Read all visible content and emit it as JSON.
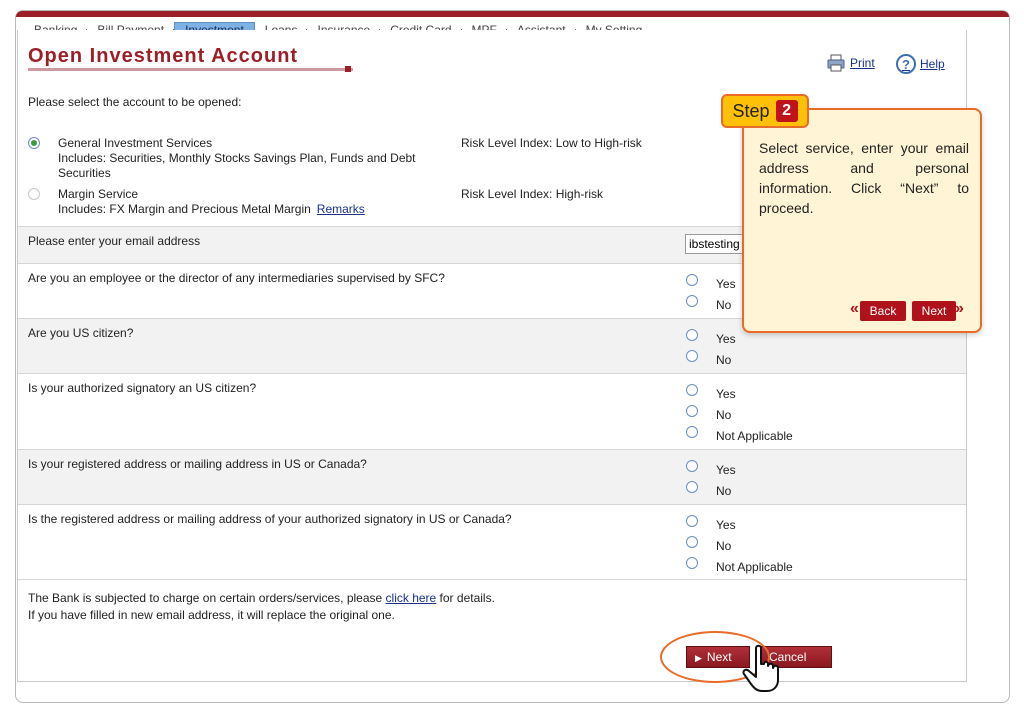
{
  "nav": {
    "tabs": [
      {
        "label": "Banking"
      },
      {
        "label": "Bill Payment"
      },
      {
        "label": "Investment",
        "active": true
      },
      {
        "label": "Loans"
      },
      {
        "label": "Insurance"
      },
      {
        "label": "Credit Card"
      },
      {
        "label": "MPF"
      },
      {
        "label": "Assistant"
      },
      {
        "label": "My Setting"
      }
    ]
  },
  "page": {
    "title": "Open Investment Account",
    "print_label": "Print",
    "help_label": "Help",
    "prompt": "Please select the account to be opened:"
  },
  "accounts": [
    {
      "name": "General Investment Services",
      "includes": "Includes: Securities, Monthly Stocks Savings Plan, Funds and Debt Securities",
      "risk": "Risk Level Index: Low to High-risk",
      "selected": true
    },
    {
      "name": "Margin Service",
      "includes": "Includes: FX Margin and Precious Metal Margin",
      "remarks": "Remarks",
      "risk": "Risk Level Index: High-risk",
      "selected": false
    }
  ],
  "email": {
    "question": "Please enter your email address",
    "value": "ibstesting"
  },
  "questions": [
    {
      "text": "Are you an employee or the director of any intermediaries supervised by SFC?",
      "options": [
        "Yes",
        "No"
      ]
    },
    {
      "text": "Are you US citizen?",
      "options": [
        "Yes",
        "No"
      ]
    },
    {
      "text": "Is your authorized signatory an US citizen?",
      "options": [
        "Yes",
        "No",
        "Not Applicable"
      ]
    },
    {
      "text": "Is your registered address or mailing address in US or Canada?",
      "options": [
        "Yes",
        "No"
      ]
    },
    {
      "text": "Is the registered address or mailing address of your authorized signatory in US or Canada?",
      "options": [
        "Yes",
        "No",
        "Not Applicable"
      ]
    }
  ],
  "footer": {
    "line1_a": "The Bank is subjected to charge on certain orders/services, please ",
    "line1_link": "click here",
    "line1_b": " for details.",
    "line2": "If you have filled in new email address, it will replace the original one."
  },
  "buttons": {
    "next": "Next",
    "cancel": "Cancel"
  },
  "tutorial": {
    "step_label": "Step",
    "step_number": "2",
    "text": "Select service, enter your email address and personal information. Click “Next” to proceed.",
    "back_label": "Back",
    "next_label": "Next"
  },
  "colors": {
    "brand": "#9c1f27",
    "highlight": "#e86b2a",
    "step_bg": "#fff5d6",
    "active_tab": "#7fb2e4"
  }
}
